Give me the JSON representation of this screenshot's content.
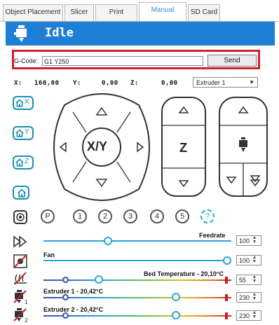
{
  "tabs": [
    {
      "label": "Object Placement"
    },
    {
      "label": "Slicer"
    },
    {
      "label": "Print Preview"
    },
    {
      "label": "Manual Control"
    },
    {
      "label": "SD Card"
    }
  ],
  "header": {
    "status": "Idle"
  },
  "gcode": {
    "label": "G-Code:",
    "value": "G1 Y250",
    "send_label": "Send"
  },
  "coords": {
    "x_label": "X:",
    "x_value": "160,00",
    "y_label": "Y:",
    "y_value": "0,00",
    "z_label": "Z:",
    "z_value": "0,00",
    "extruder_select": "Extruder 1"
  },
  "home": {
    "x": "X",
    "y": "Y",
    "z": "Z"
  },
  "pad": {
    "xy_label": "X/Y",
    "z_label": "Z"
  },
  "slots": [
    "P",
    "1",
    "2",
    "3",
    "4",
    "5",
    "?"
  ],
  "controls": {
    "feedrate": {
      "label": "Feedrate",
      "value": "100",
      "level": 0.35
    },
    "fan": {
      "label": "Fan",
      "value": "100",
      "level": 1.0
    },
    "bed": {
      "label": "Bed Temperature - 20,10°C",
      "value": "55",
      "level": 0.3
    },
    "extruder1": {
      "label": "Extruder 1 - 20,42°C",
      "value": "230",
      "level": 0.72
    },
    "extruder2": {
      "label": "Extruder 2 - 20,42°C",
      "value": "230",
      "level": 0.72
    }
  },
  "colors": {
    "accent": "#1f7fd4",
    "highlight": "#d0202a",
    "knob": "#2aa6d6"
  }
}
